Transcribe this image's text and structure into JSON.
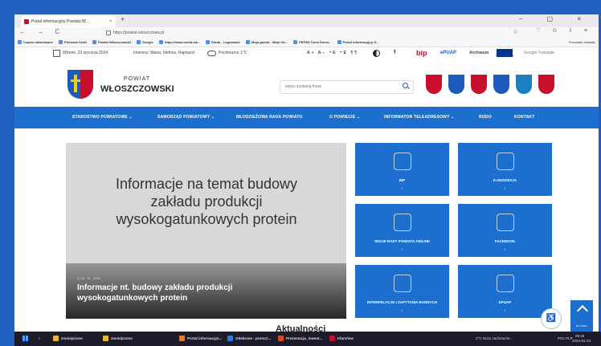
{
  "browser": {
    "tab_title": "Portal informacyjny Powiatu W...",
    "tab_close": "×",
    "new_tab": "+",
    "window_controls": "– ▢ ×",
    "nav_buttons": "← → C",
    "url": "https://powiat-wloszczowa.pl",
    "star_icon": "☆",
    "addr_icons": "♡ ⊙ ⇩ ≡",
    "bookmarks": [
      "Często odwiedzane",
      "Pierwsze kroki",
      "Powiat Włoszczowski",
      "Google",
      "https://www.oneta-sw...",
      "Edota - Logowanie",
      "Moja gazeta - Moje Ga...",
      "PEFSN Tools Demo...",
      "Portal informacyjny G..."
    ],
    "other_bookmarks": "Pozostałe zakładki"
  },
  "utility": {
    "date": "Wtorek, 23 stycznia 2024",
    "names": "Imieniny: Maria, Idefons, Rajmund",
    "weather": "Pochmurno 1°C",
    "font_sizes": "A+ A− ⁼E ⁼E ¶¶",
    "fb": "f",
    "bip": "bip",
    "epuap": "ePUAP",
    "archive": "Archiwum",
    "ue_label": "Unia Europejska",
    "translate": "Google Translate"
  },
  "header": {
    "powiat": "POWIAT",
    "name": "WŁOSZCZOWSKI",
    "search_placeholder": "wpisz szukaną frazę",
    "crest_colors": [
      "#c8102e",
      "#1d5bbf",
      "#c8102e",
      "#1d5bbf",
      "#1d7fbf",
      "#c8102e"
    ]
  },
  "menu": [
    "STAROSTWO POWIATOWE ⌄",
    "SAMORZĄD POWIATOWY ⌄",
    "MŁODZIEŻOWA RADA POWIATU",
    "O POWIECIE ⌄",
    "INFORMATOR TELEADRESOWY ⌄",
    "RODO",
    "KONTAKT"
  ],
  "slide": {
    "headline": "Informacje na temat budowy zakładu produkcji wysokogatunkowych protein",
    "date": "◷ 18 . 01 . 2024",
    "title": "Informacje nt. budowy zakładu produkcji wysokogatunkowych protein"
  },
  "tiles": [
    {
      "label": "BIP",
      "arrow": "›"
    },
    {
      "label": "E-GEODEZJA",
      "arrow": "›"
    },
    {
      "label": "SESJE RADY POWIATU ONLINE",
      "arrow": "›"
    },
    {
      "label": "FACEBOOK",
      "arrow": "›"
    },
    {
      "label": "INTERPELACJE I ZAPYTANIA RADNYCH",
      "arrow": "›"
    },
    {
      "label": "EPUAP",
      "arrow": "›"
    }
  ],
  "section_heading": "Aktualności",
  "to_top_label": "DO GÓRY",
  "taskbar": {
    "items": [
      "zmniejszone",
      "zmniejszone",
      "Portal informacyjn...",
      "Odebrane - prom@...",
      "Prezentacja_inwest...",
      "IrfanView"
    ],
    "weather": "2°C Duże zachmurze...",
    "lang": "POL PLP",
    "time": "09:36",
    "date": "2024-01-23"
  }
}
